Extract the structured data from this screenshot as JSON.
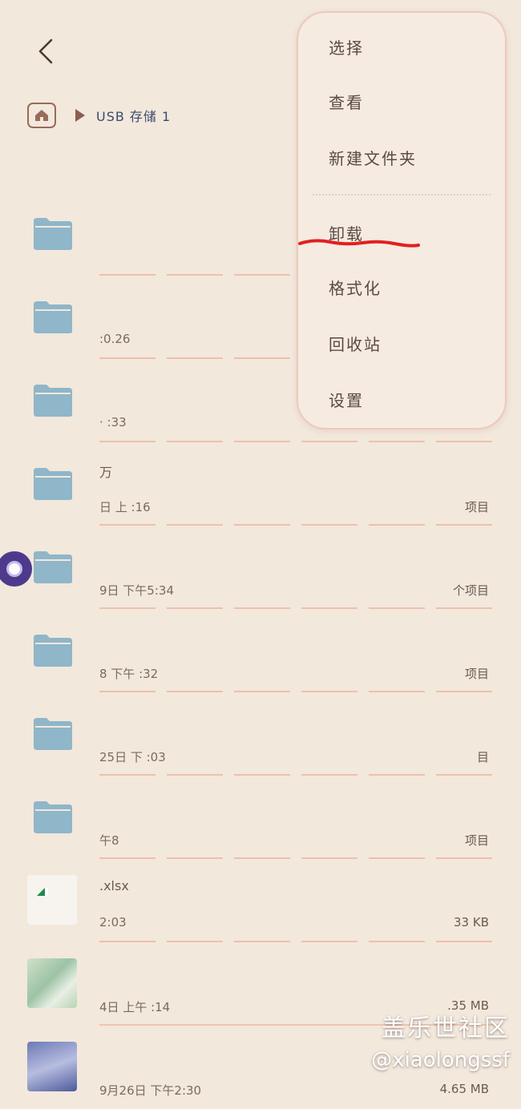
{
  "breadcrumb": {
    "label": "USB 存储 1"
  },
  "menu": {
    "items": [
      {
        "label": "选择"
      },
      {
        "label": "查看"
      },
      {
        "label": "新建文件夹"
      },
      {
        "label": "卸载"
      },
      {
        "label": "格式化"
      },
      {
        "label": "回收站"
      },
      {
        "label": "设置"
      }
    ]
  },
  "files": [
    {
      "name": "",
      "meta": "",
      "size": ""
    },
    {
      "name": "",
      "meta": ":0.26",
      "size": ""
    },
    {
      "name": "",
      "meta": "· :33",
      "size": ""
    },
    {
      "name": "万",
      "meta": "日 上 :16",
      "size": "项目"
    },
    {
      "name": "",
      "meta": "9日 下午5:34",
      "size": "个项目"
    },
    {
      "name": "",
      "meta": "8 下午 :32",
      "size": "项目"
    },
    {
      "name": "",
      "meta": "25日 下 :03",
      "size": "目"
    },
    {
      "name": "",
      "meta": "午8",
      "size": "项目"
    },
    {
      "name": ".xlsx",
      "meta": "2:03",
      "size": "33 KB"
    },
    {
      "name": "",
      "meta": "4日 上午 :14",
      "size": ".35 MB"
    },
    {
      "name": "",
      "meta": "9月26日 下午2:30",
      "size": "4.65 MB"
    }
  ],
  "watermark": {
    "line1": "盖乐世社区",
    "line2": "@xiaolongssf"
  },
  "colors": {
    "background": "#f2e8dc",
    "folder": "#8fb6c9",
    "accent_underline": "#e02020"
  }
}
